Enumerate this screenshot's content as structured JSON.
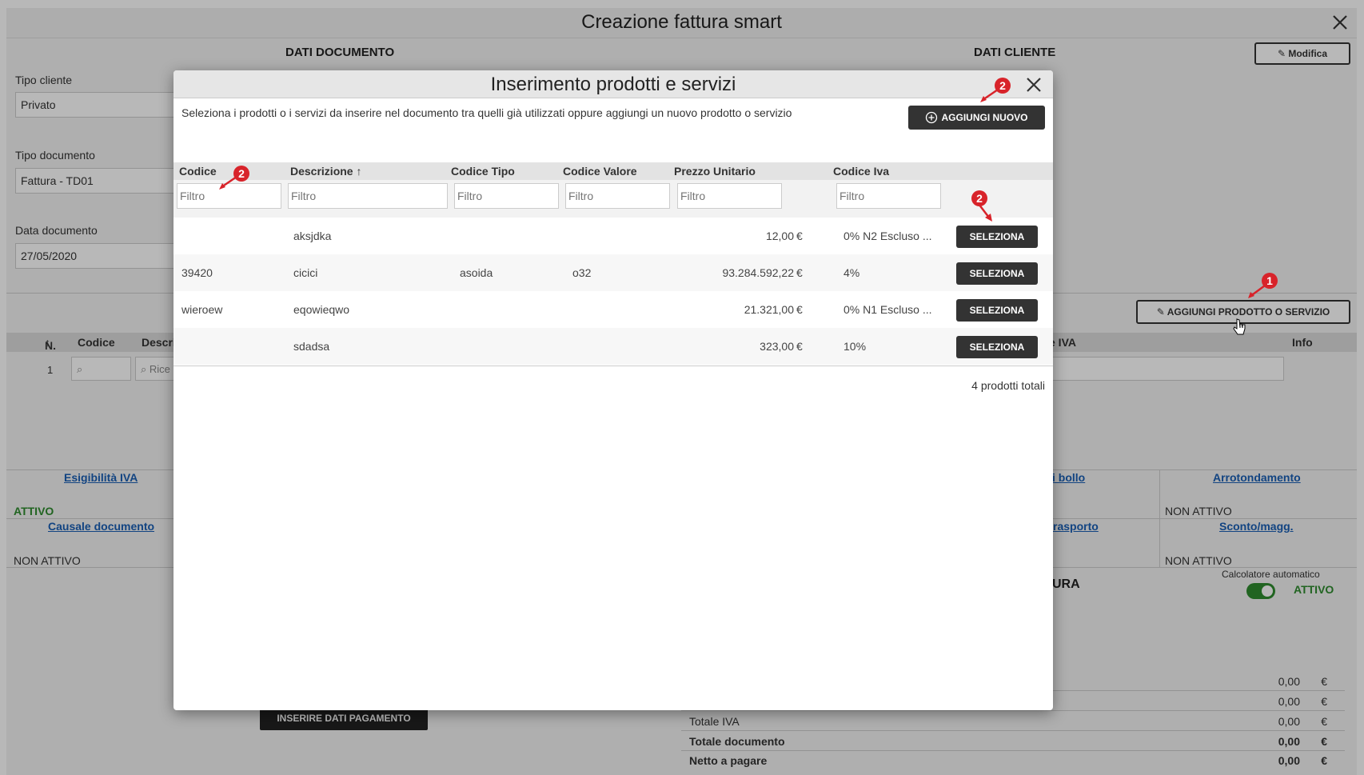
{
  "app": {
    "title": "Creazione fattura smart",
    "dati_documento_title": "DATI DOCUMENTO",
    "dati_cliente_title": "DATI CLIENTE",
    "modifica_label": "Modifica",
    "tipo_cliente_label": "Tipo cliente",
    "tipo_cliente_value": "Privato",
    "tipo_documento_label": "Tipo documento",
    "tipo_documento_value": "Fattura - TD01",
    "data_documento_label": "Data documento",
    "data_documento_value": "27/05/2020",
    "aggiungi_prodotto_label": "AGGIUNGI PRODOTTO O SERVIZIO",
    "grid_headers": {
      "n": "N.",
      "codice": "Codice",
      "descr": "Descri",
      "iva": "e IVA",
      "info": "Info"
    },
    "grid_row_number": "1",
    "search_placeholder": "Rice",
    "esigibilita_iva": "Esigibilità IVA",
    "esigibilita_status": "ATTIVO",
    "causale_documento": "Causale documento",
    "causale_status": "NON ATTIVO",
    "bollo_link": "i bollo",
    "trasporto_link": "rasporto",
    "arrotondamento": "Arrotondamento",
    "arrotondamento_status": "NON ATTIVO",
    "sconto": "Sconto/magg.",
    "sconto_status": "NON ATTIVO",
    "ura_label": "URA",
    "calcolatore_label": "Calcolatore automatico",
    "calcolatore_status": "ATTIVO",
    "inserire_pagamento_label": "INSERIRE DATI PAGAMENTO",
    "totals": [
      {
        "label": "",
        "value": "0,00",
        "currency": "€"
      },
      {
        "label": "",
        "value": "0,00",
        "currency": "€"
      },
      {
        "label": "Totale IVA",
        "value": "0,00",
        "currency": "€"
      },
      {
        "label": "Totale documento",
        "value": "0,00",
        "currency": "€"
      },
      {
        "label": "Netto a pagare",
        "value": "0,00",
        "currency": "€"
      }
    ]
  },
  "modal": {
    "title": "Inserimento prodotti e servizi",
    "description": "Seleziona i prodotti o i servizi da inserire nel documento tra quelli già utilizzati oppure aggiungi un nuovo prodotto o servizio",
    "add_new_label": "AGGIUNGI NUOVO",
    "columns": {
      "codice": "Codice",
      "descrizione": "Descrizione",
      "sort_glyph": "↑",
      "codice_tipo": "Codice Tipo",
      "codice_valore": "Codice Valore",
      "prezzo_unitario": "Prezzo Unitario",
      "codice_iva": "Codice Iva"
    },
    "filter_placeholder": "Filtro",
    "select_label": "SELEZIONA",
    "rows": [
      {
        "codice": "",
        "descrizione": "aksjdka",
        "codice_tipo": "",
        "codice_valore": "",
        "prezzo": "12,00",
        "currency": "€",
        "iva": "0% N2 Escluso ..."
      },
      {
        "codice": "39420",
        "descrizione": "cicici",
        "codice_tipo": "asoida",
        "codice_valore": "o32",
        "prezzo": "93.284.592,22",
        "currency": "€",
        "iva": "4%"
      },
      {
        "codice": "wieroew",
        "descrizione": "eqowieqwo",
        "codice_tipo": "",
        "codice_valore": "",
        "prezzo": "21.321,00",
        "currency": "€",
        "iva": "0% N1 Escluso ..."
      },
      {
        "codice": "",
        "descrizione": "sdadsa",
        "codice_tipo": "",
        "codice_valore": "",
        "prezzo": "323,00",
        "currency": "€",
        "iva": "10%"
      }
    ],
    "total_count": "4 prodotti totali"
  },
  "markers": {
    "one": "1",
    "two": "2"
  },
  "colors": {
    "accent_dark": "#333333",
    "status_green": "#2e8b2e",
    "link_blue": "#1a5fb4",
    "marker_red": "#d8232a"
  }
}
